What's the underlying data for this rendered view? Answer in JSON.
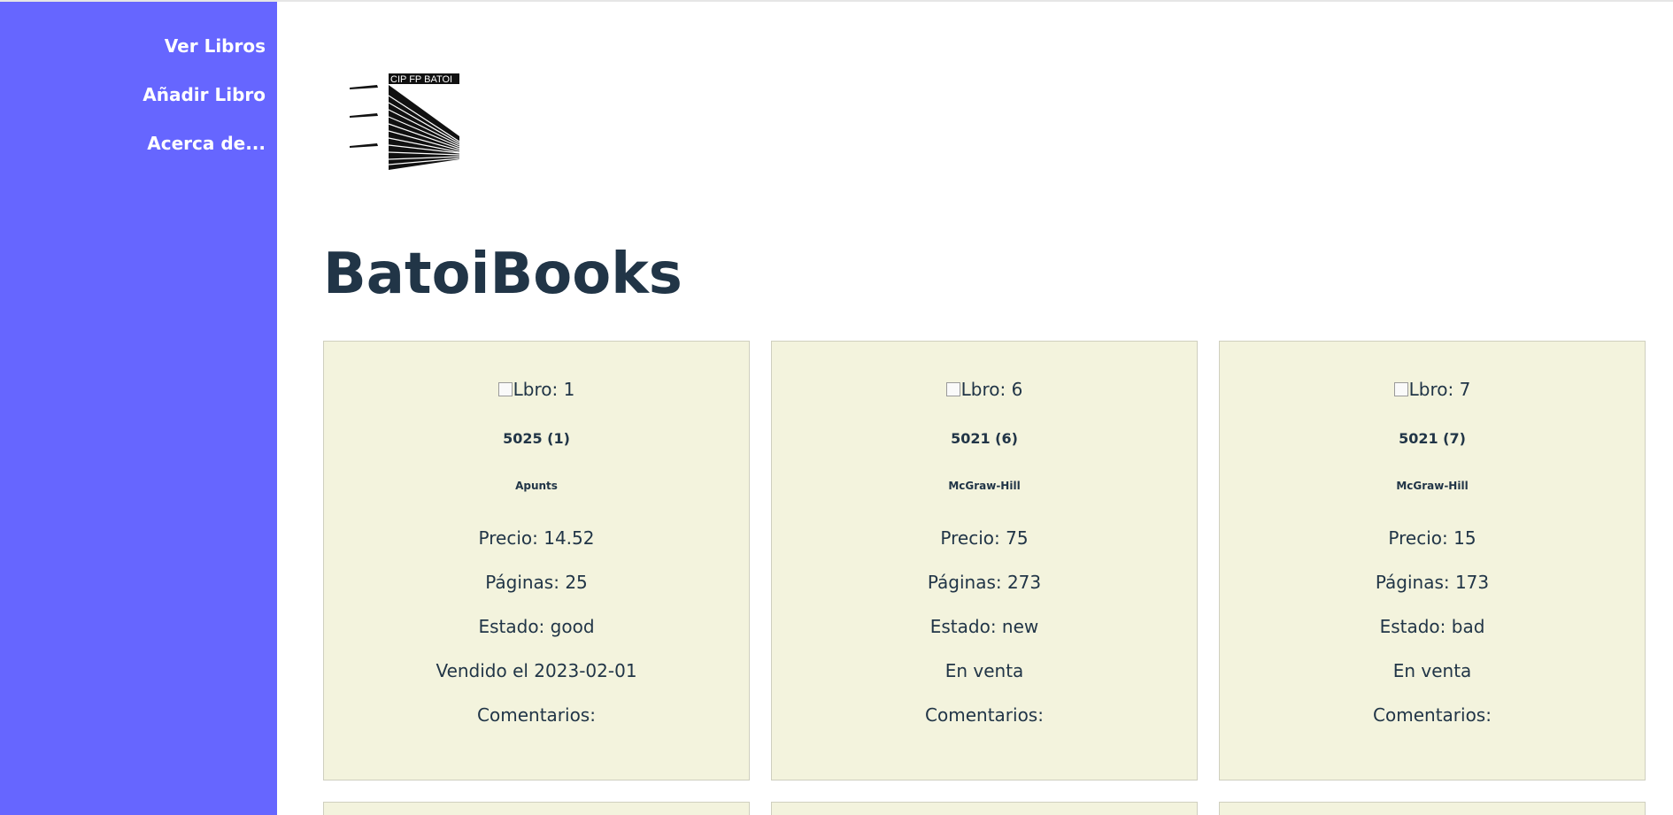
{
  "sidebar": {
    "items": [
      {
        "label": "Ver Libros"
      },
      {
        "label": "Añadir Libro"
      },
      {
        "label": "Acerca de..."
      }
    ]
  },
  "logo": {
    "text": "CIP FP BATOI"
  },
  "page": {
    "title": "BatoiBooks"
  },
  "books": [
    {
      "image_alt": "Lbro: 1",
      "title": "5025 (1)",
      "publisher": "Apunts",
      "price": "Precio: 14.52",
      "pages": "Páginas: 25",
      "state": "Estado: good",
      "sale_status": "Vendido el 2023-02-01",
      "comments": "Comentarios:"
    },
    {
      "image_alt": "Lbro: 6",
      "title": "5021 (6)",
      "publisher": "McGraw-Hill",
      "price": "Precio: 75",
      "pages": "Páginas: 273",
      "state": "Estado: new",
      "sale_status": "En venta",
      "comments": "Comentarios:"
    },
    {
      "image_alt": "Lbro: 7",
      "title": "5021 (7)",
      "publisher": "McGraw-Hill",
      "price": "Precio: 15",
      "pages": "Páginas: 173",
      "state": "Estado: bad",
      "sale_status": "En venta",
      "comments": "Comentarios:"
    }
  ],
  "colors": {
    "sidebar": "#6666ff",
    "card_background": "#f3f3dd",
    "text": "#213547"
  }
}
